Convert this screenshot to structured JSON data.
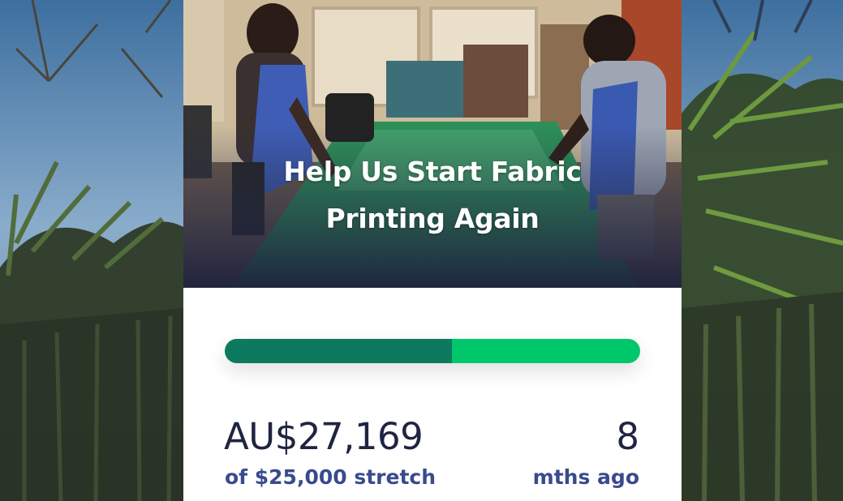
{
  "campaign": {
    "title": "Help Us Start Fabric Printing Again",
    "title_line1": "Help Us Start Fabric",
    "title_line2": "Printing Again",
    "image_description_icon": "workshop-photo",
    "progress": {
      "fraction": 0.547
    },
    "amount_raised": "AU$27,169",
    "goal_text": "of $25,000 stretch",
    "time_value": "8",
    "time_unit": "mths ago"
  },
  "colors": {
    "progress_fill": "#0d7a5f",
    "progress_track": "#00c76c",
    "heading": "#1f2540",
    "subtext": "#3a4b8c",
    "card_background": "#ffffff"
  }
}
